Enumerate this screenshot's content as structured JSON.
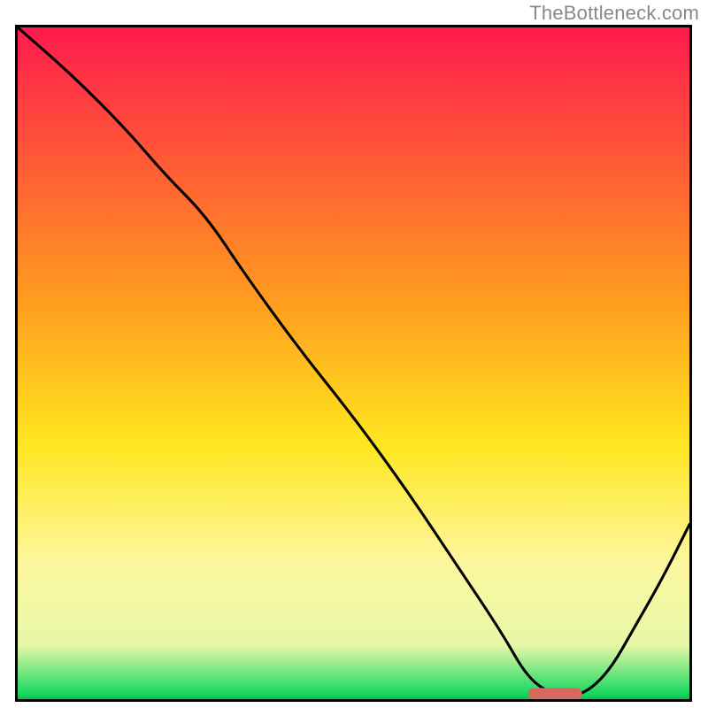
{
  "watermark": "TheBottleneck.com",
  "chart_data": {
    "type": "line",
    "title": "",
    "xlabel": "",
    "ylabel": "",
    "xlim": [
      0,
      100
    ],
    "ylim": [
      0,
      100
    ],
    "grid": false,
    "legend": false,
    "description": "Bottleneck-style curve on a vertical gradient from red (top) through orange/yellow to green (bottom). Black curve starts top-left, descends, dips to near zero around x≈80, then rises.",
    "gradient_stops": [
      {
        "offset": 0,
        "color": "#ff1a4d"
      },
      {
        "offset": 40,
        "color": "#ff9a1f"
      },
      {
        "offset": 62,
        "color": "#ffe61f"
      },
      {
        "offset": 80,
        "color": "#fdf7a0"
      },
      {
        "offset": 92,
        "color": "#e6f8a7"
      },
      {
        "offset": 99.2,
        "color": "#18d860"
      },
      {
        "offset": 100,
        "color": "#0bbf4f"
      }
    ],
    "series": [
      {
        "name": "bottleneck-curve",
        "color": "#000000",
        "x": [
          0,
          8,
          16,
          22,
          28,
          34,
          42,
          50,
          58,
          66,
          72,
          76,
          80,
          84,
          88,
          92,
          96,
          100
        ],
        "y": [
          100,
          93,
          85,
          78,
          72,
          63,
          52,
          42,
          31,
          19,
          10,
          3,
          0.5,
          0.5,
          4,
          11,
          18,
          26
        ]
      }
    ],
    "marker": {
      "name": "optimal-marker",
      "color": "#d9685f",
      "shape": "rounded-bar",
      "x_center": 80,
      "x_width": 8,
      "y": 0.8
    }
  }
}
